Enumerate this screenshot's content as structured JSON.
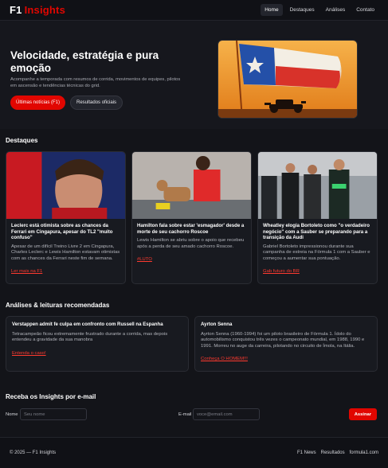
{
  "header": {
    "logo_f1": "F1",
    "logo_insights": "Insights",
    "nav": [
      "Home",
      "Destaques",
      "Análises",
      "Contato"
    ]
  },
  "hero": {
    "title": "Velocidade, estratégia e pura emoção",
    "subtitle": "Acompanhe a temporada com resumos de corrida, movimentos de equipes, pilotos em ascensão e tendências técnicas do grid.",
    "btn_primary": "Últimas notícias (F1)",
    "btn_secondary": "Resultados oficiais"
  },
  "highlights": {
    "title": "Destaques",
    "cards": [
      {
        "title": "Leclerc está otimista sobre as chances da Ferrari em Cingapura, apesar do TL2 \"muito confuso\"",
        "desc": "Apesar de um difícil Treino Livre 2 em Cingapura, Charles Leclerc e Lewis Hamilton estavam otimistas com as chances da Ferrari neste fim de semana.",
        "link": "Ler mais na F1"
      },
      {
        "title": "Hamilton fala sobre estar 'esmagador' desde a morte de seu cachorro Roscoe",
        "desc": "Lewis Hamilton se abriu sobre o apoio que recebeu após a perda de seu amado cachorro Roscoe.",
        "link": "#LUTO"
      },
      {
        "title": "Wheatley elogia Bortoleto como \"o verdadeiro negócio\" com a Sauber se preparando para a transição da Audi",
        "desc": "Gabriel Bortoleto impressionou durante sua campanha de estreia na Fórmula 1 com a Sauber e começou a aumentar sua pontuação.",
        "link": "Gab futuro do BR"
      }
    ]
  },
  "analyses": {
    "title": "Análises & leituras recomendadas",
    "items": [
      {
        "title": "Verstappen admit fe culpa em confronto com Russell na Espanha",
        "desc": "Tetracampeão ficou extremamente frustrado durante a corrida, mas depois entendeu a gravidade da sua manobra",
        "link": "Entenda o caso!"
      },
      {
        "title": "Ayrton Senna",
        "desc": "Ayrton Senna (1960-1994) foi um piloto brasileiro de Fórmula 1. Ídolo do automobilismo conquistou três vezes o campeonato mundial, em 1988, 1990 e 1991. Morreu no auge da carreira, pilotando no circuito de Ímola, na Itália.",
        "link": "Conheça O HOMEM!!!"
      }
    ]
  },
  "newsletter": {
    "title": "Receba os Insights por e-mail",
    "name_label": "Nome",
    "name_placeholder": "Seu nome",
    "email_label": "E-mail",
    "email_placeholder": "voce@email.com",
    "button": "Assinar"
  },
  "footer": {
    "copyright": "© 2025 — F1 Insights",
    "links": [
      "F1 News",
      "Resultados",
      "formula1.com"
    ]
  },
  "colors": {
    "accent": "#e10600",
    "background": "#131419",
    "card": "#181a20"
  }
}
